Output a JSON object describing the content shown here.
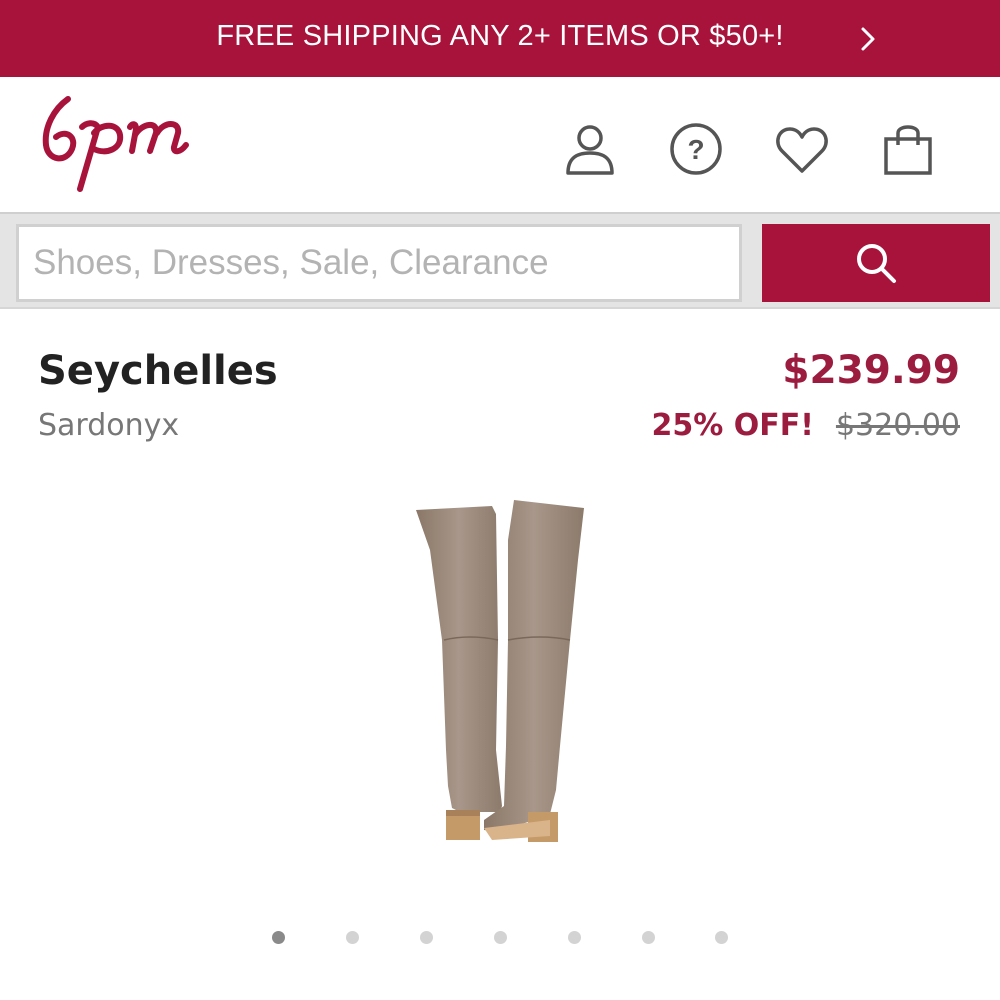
{
  "promo": {
    "text": "FREE SHIPPING ANY 2+ ITEMS OR $50+!",
    "chevron": "chevron-right-icon"
  },
  "header": {
    "logo_text": "6pm",
    "icons": [
      "account-icon",
      "help-icon",
      "favorites-icon",
      "shopping-bag-icon"
    ]
  },
  "search": {
    "placeholder": "Shoes, Dresses, Sale, Clearance",
    "value": "",
    "button_icon": "search-icon"
  },
  "product": {
    "brand": "Seychelles",
    "color": "Sardonyx",
    "price": "$239.99",
    "discount": "25% OFF!",
    "original_price": "$320.00",
    "image": "over-the-knee-suede-boots"
  },
  "carousel": {
    "total": 7,
    "active_index": 0
  },
  "colors": {
    "brand": "#a8133b",
    "price": "#9b1c3e",
    "secondary_text": "#777777"
  }
}
